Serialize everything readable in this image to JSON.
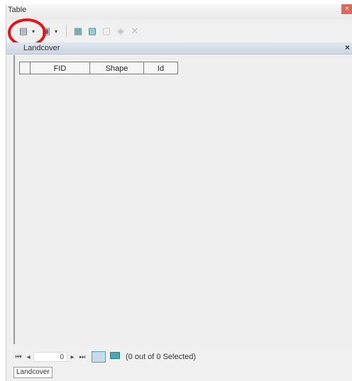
{
  "window": {
    "title": "Table",
    "close_icon": "close-icon"
  },
  "toolbar": {
    "items": [
      {
        "name": "table-options-icon",
        "glyph": "▤"
      },
      {
        "name": "related-tables-icon",
        "glyph": "▣"
      },
      {
        "name": "select-by-attributes-icon",
        "glyph": "▦"
      },
      {
        "name": "switch-selection-icon",
        "glyph": "▧"
      },
      {
        "name": "clear-selection-icon",
        "glyph": "▢"
      },
      {
        "name": "zoom-to-selected-icon",
        "glyph": "◈"
      },
      {
        "name": "delete-selected-icon",
        "glyph": "✕"
      }
    ]
  },
  "table_tab_title": "Landcover",
  "table": {
    "columns": [
      "FID",
      "Shape",
      "Id"
    ],
    "rows": []
  },
  "nav": {
    "record": "0",
    "status": "(0 out of 0 Selected)"
  },
  "tabs": [
    "Landcover"
  ],
  "colors": {
    "highlight": "#e3161b",
    "accent": "#2f8c97"
  }
}
